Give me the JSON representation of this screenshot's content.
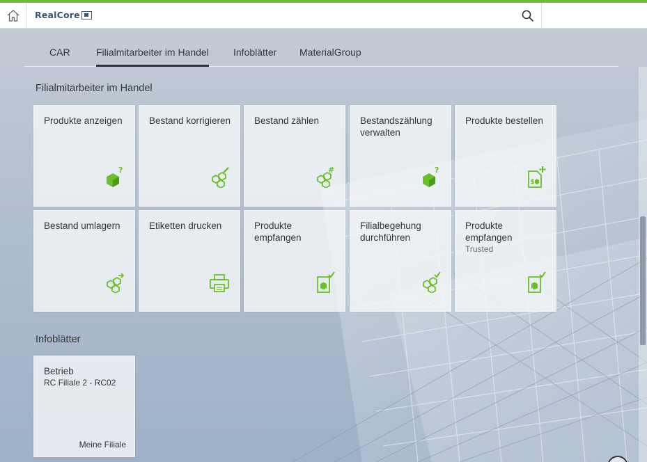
{
  "brand": {
    "name": "RealCore",
    "accent": "#6fbd3b",
    "icon_color": "#6abf2a"
  },
  "shell": {
    "home_icon": "home-icon",
    "search_icon": "search-icon"
  },
  "tabs": [
    {
      "label": "CAR",
      "active": false
    },
    {
      "label": "Filialmitarbeiter im Handel",
      "active": true
    },
    {
      "label": "Infoblätter",
      "active": false
    },
    {
      "label": "MaterialGroup",
      "active": false
    }
  ],
  "groups": [
    {
      "title": "Filialmitarbeiter im Handel",
      "tiles": [
        {
          "title": "Produkte anzeigen",
          "icon": "product-query-icon"
        },
        {
          "title": "Bestand korrigieren",
          "icon": "stock-edit-icon"
        },
        {
          "title": "Bestand zählen",
          "icon": "stock-count-icon"
        },
        {
          "title": "Bestandszählung verwalten",
          "icon": "product-query-icon"
        },
        {
          "title": "Produkte bestellen",
          "icon": "order-document-icon"
        },
        {
          "title": "Bestand umlagern",
          "icon": "stock-transfer-icon"
        },
        {
          "title": "Etiketten drucken",
          "icon": "printer-icon"
        },
        {
          "title": "Produkte empfangen",
          "icon": "receive-document-icon"
        },
        {
          "title": "Filialbegehung durchführen",
          "icon": "stock-check-icon"
        },
        {
          "title": "Produkte empfangen",
          "subtitle": "Trusted",
          "icon": "receive-document-icon"
        }
      ]
    },
    {
      "title": "Infoblätter",
      "tiles": [
        {
          "title": "Betrieb",
          "subtitle": "RC Filiale 2 - RC02",
          "footer": "Meine Filiale"
        }
      ]
    }
  ]
}
